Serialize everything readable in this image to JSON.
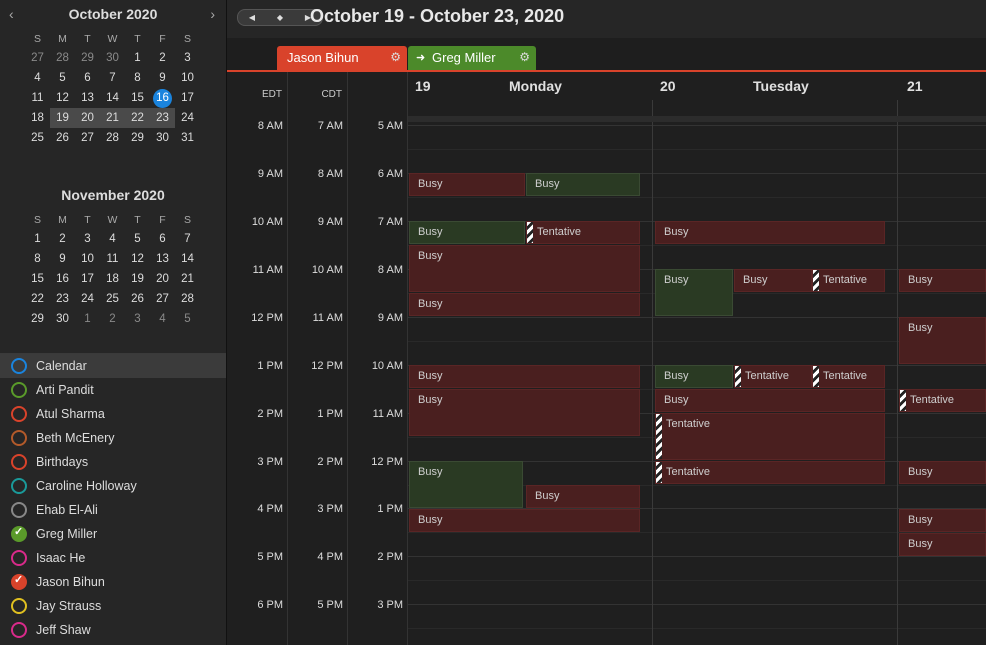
{
  "header": {
    "range_title": "October 19 - October 23, 2020"
  },
  "mini_calendars": [
    {
      "title": "October 2020",
      "dow": [
        "S",
        "M",
        "T",
        "W",
        "T",
        "F",
        "S"
      ],
      "weeks": [
        [
          "27",
          "28",
          "29",
          "30",
          "1",
          "2",
          "3"
        ],
        [
          "4",
          "5",
          "6",
          "7",
          "8",
          "9",
          "10"
        ],
        [
          "11",
          "12",
          "13",
          "14",
          "15",
          "16",
          "17"
        ],
        [
          "18",
          "19",
          "20",
          "21",
          "22",
          "23",
          "24"
        ],
        [
          "25",
          "26",
          "27",
          "28",
          "29",
          "30",
          "31"
        ]
      ]
    },
    {
      "title": "November 2020",
      "dow": [
        "S",
        "M",
        "T",
        "W",
        "T",
        "F",
        "S"
      ],
      "weeks": [
        [
          "1",
          "2",
          "3",
          "4",
          "5",
          "6",
          "7"
        ],
        [
          "8",
          "9",
          "10",
          "11",
          "12",
          "13",
          "14"
        ],
        [
          "15",
          "16",
          "17",
          "18",
          "19",
          "20",
          "21"
        ],
        [
          "22",
          "23",
          "24",
          "25",
          "26",
          "27",
          "28"
        ],
        [
          "29",
          "30",
          "1",
          "2",
          "3",
          "4",
          "5"
        ]
      ]
    }
  ],
  "nav": {
    "prev": "‹",
    "next": "›",
    "btn_left": "◀",
    "btn_mid": "◆",
    "btn_right": "▶"
  },
  "calendars": [
    {
      "label": "Calendar",
      "color": "#1a84de",
      "checked": false
    },
    {
      "label": "Arti Pandit",
      "color": "#5a9a2a",
      "checked": false
    },
    {
      "label": "Atul Sharma",
      "color": "#d9432b",
      "checked": false
    },
    {
      "label": "Beth McEnery",
      "color": "#b35a2a",
      "checked": false
    },
    {
      "label": "Birthdays",
      "color": "#d9432b",
      "checked": false
    },
    {
      "label": "Caroline Holloway",
      "color": "#1a9a9a",
      "checked": false
    },
    {
      "label": "Ehab El-Ali",
      "color": "#888888",
      "checked": false
    },
    {
      "label": "Greg Miller",
      "color": "#5a9a2a",
      "checked": true
    },
    {
      "label": "Isaac He",
      "color": "#d92a8a",
      "checked": false
    },
    {
      "label": "Jason Bihun",
      "color": "#d9432b",
      "checked": true
    },
    {
      "label": "Jay Strauss",
      "color": "#e0c020",
      "checked": false
    },
    {
      "label": "Jeff Shaw",
      "color": "#d92a8a",
      "checked": false
    }
  ],
  "tabs": [
    {
      "label": "Jason Bihun",
      "color": "#d9432b"
    },
    {
      "label": "Greg Miller",
      "color": "#5a9a2a",
      "arrow": "➜"
    }
  ],
  "gear": "⚙",
  "timezones": [
    "EDT",
    "CDT",
    ""
  ],
  "time_rows": [
    [
      "8 AM",
      "7 AM",
      "5 AM"
    ],
    [
      "9 AM",
      "8 AM",
      "6 AM"
    ],
    [
      "10 AM",
      "9 AM",
      "7 AM"
    ],
    [
      "11 AM",
      "10 AM",
      "8 AM"
    ],
    [
      "12 PM",
      "11 AM",
      "9 AM"
    ],
    [
      "1 PM",
      "12 PM",
      "10 AM"
    ],
    [
      "2 PM",
      "1 PM",
      "11 AM"
    ],
    [
      "3 PM",
      "2 PM",
      "12 PM"
    ],
    [
      "4 PM",
      "3 PM",
      "1 PM"
    ],
    [
      "5 PM",
      "4 PM",
      "2 PM"
    ],
    [
      "6 PM",
      "5 PM",
      "3 PM"
    ]
  ],
  "days": [
    {
      "num": "19",
      "name": "Monday"
    },
    {
      "num": "20",
      "name": "Tuesday"
    },
    {
      "num": "21",
      "name": ""
    }
  ],
  "events": [
    {
      "label": "Busy",
      "color": "red"
    },
    {
      "label": "Busy",
      "color": "green"
    },
    {
      "label": "Busy",
      "color": "green"
    },
    {
      "label": "Tentative",
      "color": "red",
      "tentative": true
    },
    {
      "label": "Busy",
      "color": "red"
    },
    {
      "label": "Busy",
      "color": "red"
    },
    {
      "label": "Busy",
      "color": "red"
    },
    {
      "label": "Busy",
      "color": "red"
    },
    {
      "label": "Busy",
      "color": "red"
    },
    {
      "label": "Busy",
      "color": "red"
    },
    {
      "label": "Busy",
      "color": "green"
    },
    {
      "label": "Busy",
      "color": "red"
    },
    {
      "label": "Busy",
      "color": "green"
    },
    {
      "label": "Busy",
      "color": "red"
    },
    {
      "label": "Busy",
      "color": "green"
    },
    {
      "label": "Busy",
      "color": "red"
    },
    {
      "label": "Tentative",
      "color": "red",
      "tentative": true
    },
    {
      "label": "Tentative",
      "color": "red",
      "tentative": true
    },
    {
      "label": "Busy",
      "color": "red"
    },
    {
      "label": "Busy",
      "color": "red"
    },
    {
      "label": "Busy",
      "color": "red"
    },
    {
      "label": "Tentative",
      "color": "red",
      "tentative": true
    },
    {
      "label": "Tentative",
      "color": "red",
      "tentative": true
    },
    {
      "label": "Tentative",
      "color": "red",
      "tentative": true
    },
    {
      "label": "Tentative",
      "color": "red",
      "tentative": true
    },
    {
      "label": "Busy",
      "color": "red"
    },
    {
      "label": "Busy",
      "color": "red"
    },
    {
      "label": "Busy",
      "color": "red"
    },
    {
      "label": "Busy",
      "color": "red"
    }
  ]
}
